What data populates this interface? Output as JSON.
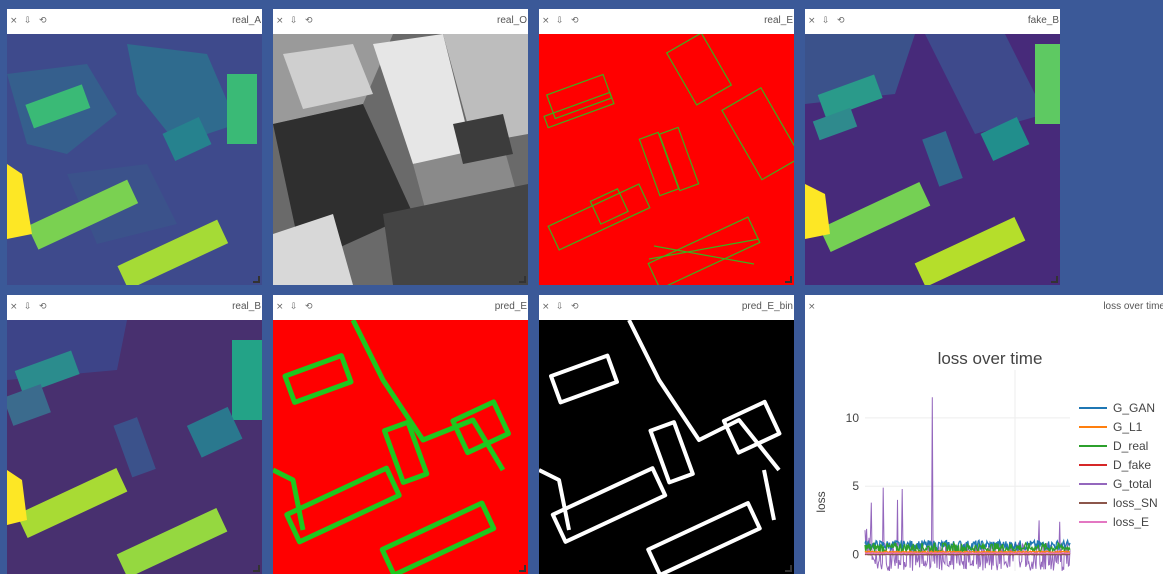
{
  "controls": {
    "close": "×",
    "download": "⇩",
    "reset": "⟲"
  },
  "panes": [
    {
      "title": "real_A"
    },
    {
      "title": "real_O"
    },
    {
      "title": "real_E"
    },
    {
      "title": "fake_B"
    },
    {
      "title": "real_B"
    },
    {
      "title": "pred_E"
    },
    {
      "title": "pred_E_bin"
    },
    {
      "title": "loss over time"
    }
  ],
  "colors": {
    "viridis_dark": "#45206a",
    "viridis_mid": "#2c6e8e",
    "viridis_teal": "#23a387",
    "viridis_green": "#5ec962",
    "viridis_yellow": "#ede427",
    "edge_red": "#ff0000",
    "edge_green": "#00d000"
  },
  "chart_data": {
    "type": "line",
    "title": "loss over time",
    "ylabel": "loss",
    "xlabel": "",
    "yticks": [
      0,
      5,
      10
    ],
    "ylim": [
      -1.2,
      13.5
    ],
    "grid": true,
    "legend_position": "right",
    "series": [
      {
        "name": "G_GAN",
        "color": "#1f77b4",
        "base": 0.7,
        "noise": 0.35
      },
      {
        "name": "G_L1",
        "color": "#ff7f0e",
        "base": 0.2,
        "noise": 0.05
      },
      {
        "name": "D_real",
        "color": "#2ca02c",
        "base": 0.5,
        "noise": 0.35
      },
      {
        "name": "D_fake",
        "color": "#d62728",
        "base": 0.05,
        "noise": 0.05
      },
      {
        "name": "G_total",
        "color": "#9467bd",
        "base": -0.3,
        "noise": 0.9,
        "peaks": [
          [
            0.03,
            3.8
          ],
          [
            0.09,
            4.9
          ],
          [
            0.16,
            4.0
          ],
          [
            0.18,
            4.8
          ],
          [
            0.33,
            11.5
          ],
          [
            0.85,
            2.5
          ],
          [
            0.95,
            2.4
          ]
        ]
      },
      {
        "name": "loss_SN",
        "color": "#8c564b",
        "base": 0.0,
        "noise": 0.02
      },
      {
        "name": "loss_E",
        "color": "#e377c2",
        "base": 0.1,
        "noise": 0.02
      }
    ]
  }
}
